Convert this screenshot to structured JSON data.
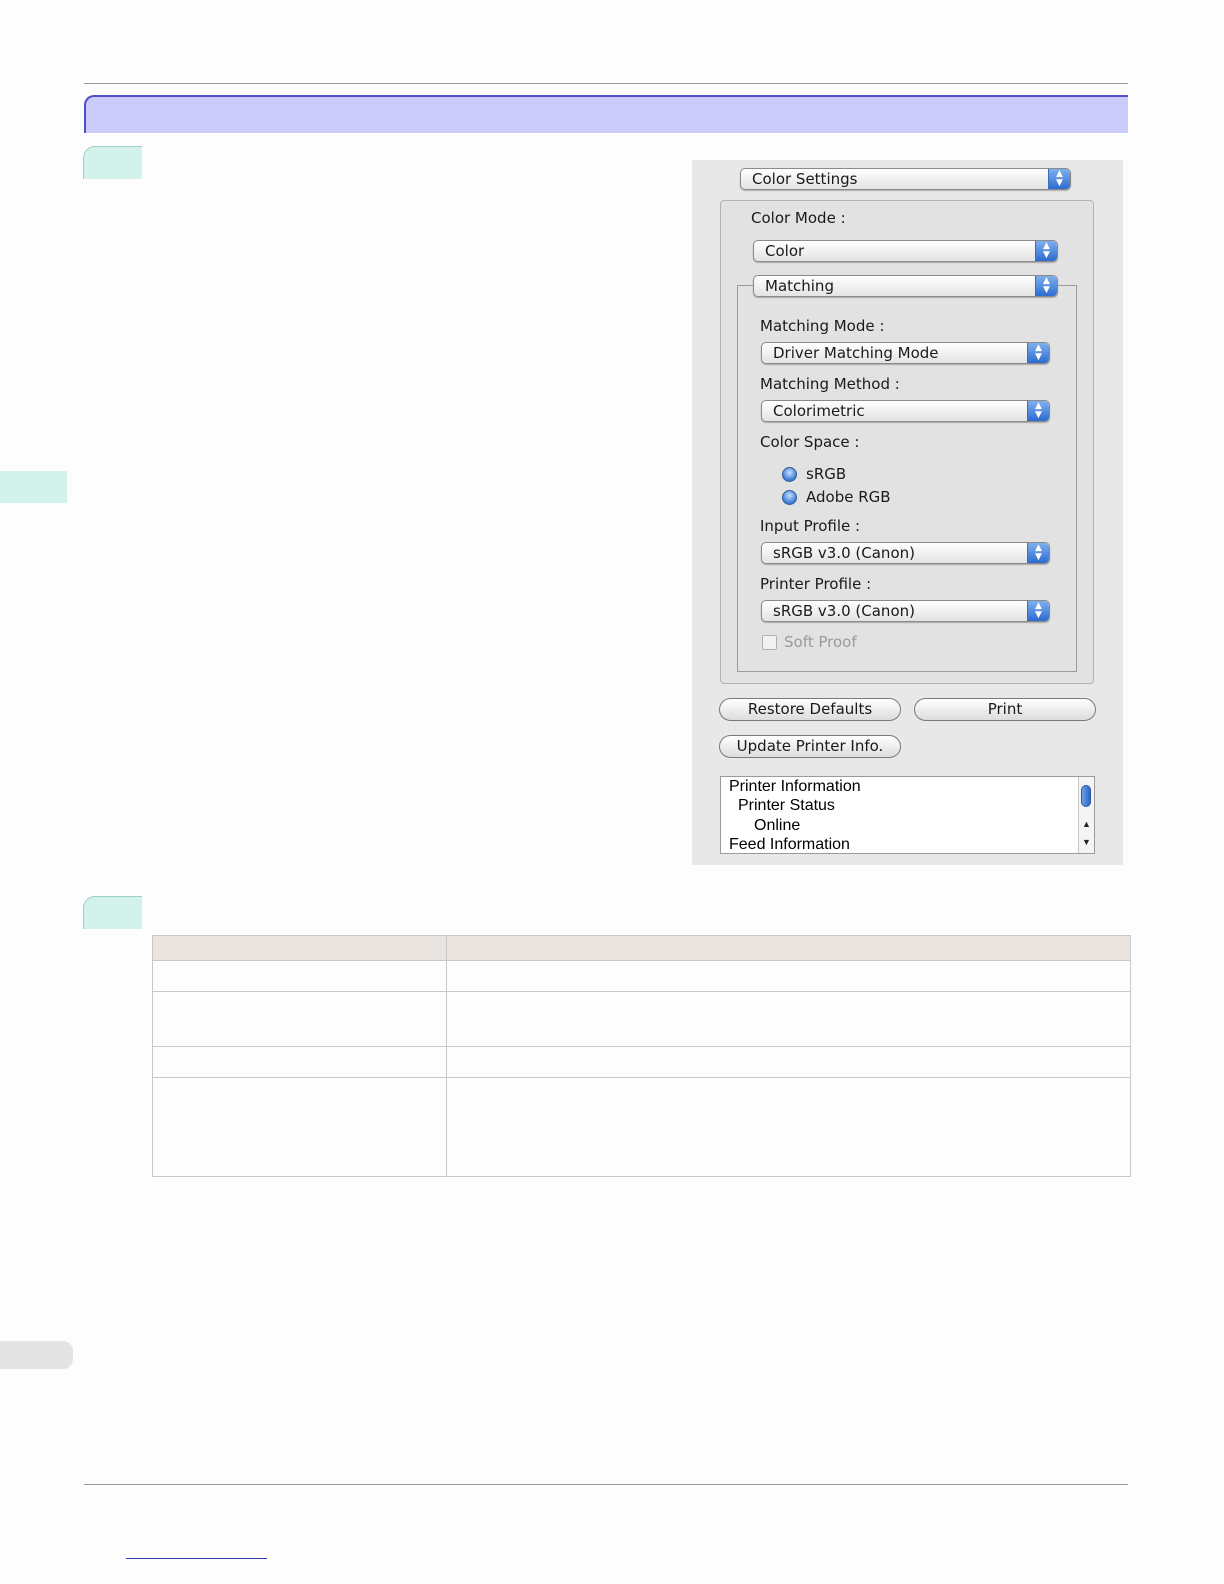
{
  "dialog": {
    "panel_popup": "Color Settings",
    "color_mode_label": "Color Mode :",
    "color_mode_value": "Color",
    "matching_section": "Matching",
    "matching_mode_label": "Matching Mode :",
    "matching_mode_value": "Driver Matching Mode",
    "matching_method_label": "Matching Method :",
    "matching_method_value": "Colorimetric",
    "color_space_label": "Color Space :",
    "color_space_options": [
      "sRGB",
      "Adobe RGB"
    ],
    "input_profile_label": "Input Profile :",
    "input_profile_value": "sRGB v3.0 (Canon)",
    "printer_profile_label": "Printer Profile :",
    "printer_profile_value": "sRGB v3.0 (Canon)",
    "soft_proof_label": "Soft Proof",
    "restore_defaults_label": "Restore Defaults",
    "print_label": "Print",
    "update_printer_info_label": "Update Printer Info.",
    "info_list": [
      "Printer Information",
      "Printer Status",
      "Online",
      "Feed Information"
    ]
  },
  "table": {
    "headers": [
      "",
      ""
    ],
    "rows": [
      [
        "",
        ""
      ],
      [
        "",
        ""
      ],
      [
        "",
        ""
      ],
      [
        "",
        ""
      ]
    ]
  }
}
